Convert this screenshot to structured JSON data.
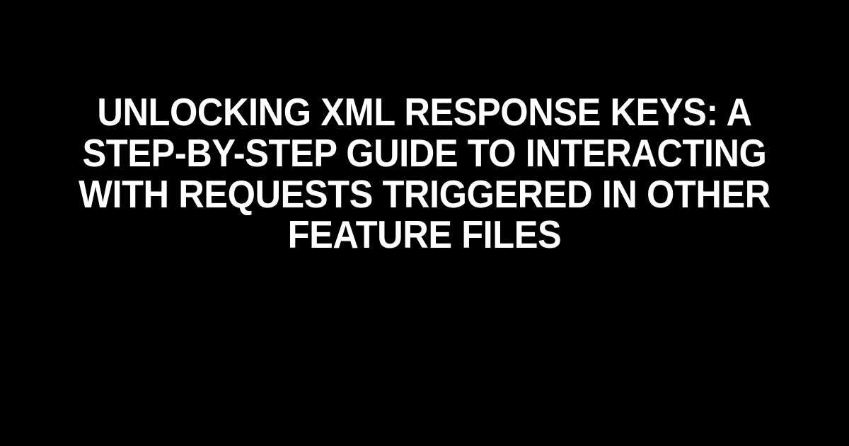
{
  "headline": "Unlocking XML Response Keys: A Step-by-Step Guide to Interacting with Requests Triggered in Other Feature Files"
}
